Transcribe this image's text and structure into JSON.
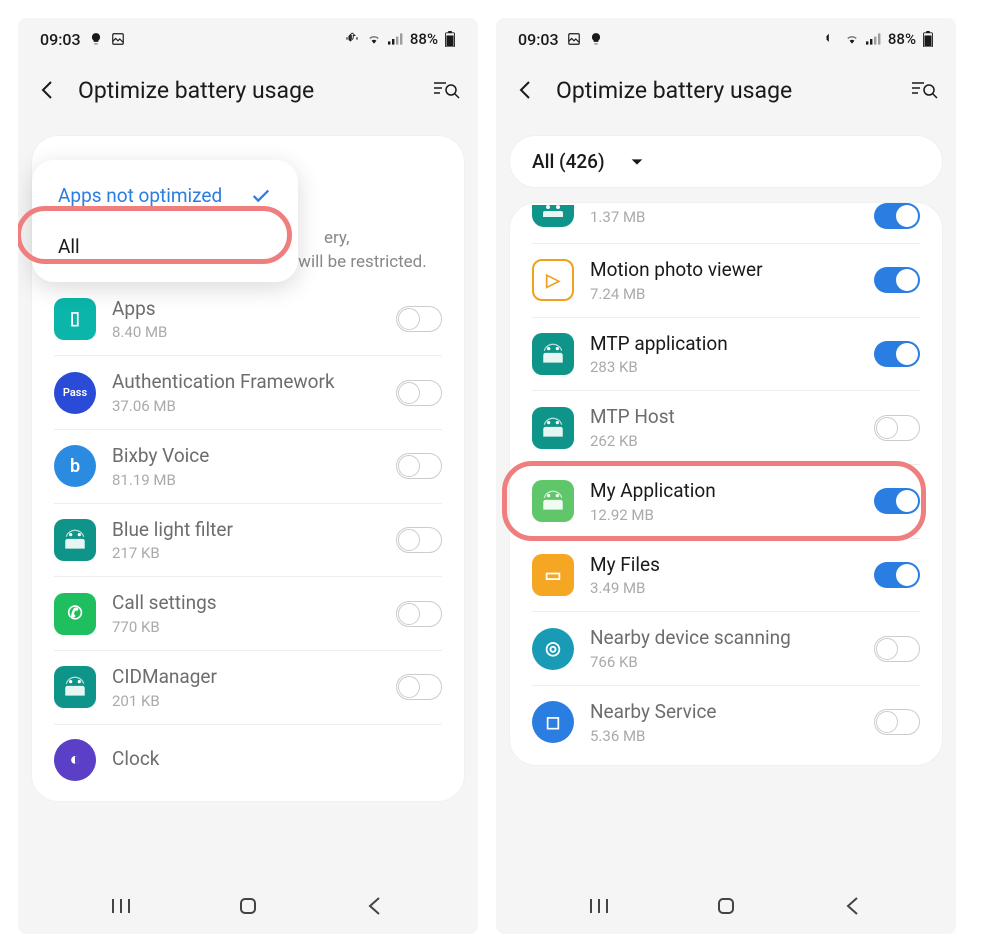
{
  "status": {
    "time": "09:03",
    "battery_pct": "88%"
  },
  "header": {
    "title": "Optimize battery usage"
  },
  "left_screen": {
    "dropdown": {
      "option_selected": "Apps not optimized",
      "option_all": "All"
    },
    "description_tail": "but some background functions will be restricted.",
    "description_partial_word": "ery,",
    "apps": [
      {
        "name": "Apps",
        "size": "8.40 MB",
        "icon_bg": "#0bb5a9",
        "icon_shape": "square",
        "glyph": "▯",
        "active": false,
        "on": false
      },
      {
        "name": "Authentication Framework",
        "size": "37.06 MB",
        "icon_bg": "#2a4bd7",
        "icon_shape": "circle",
        "glyph": "Pass",
        "glyph_size": "11px",
        "active": false,
        "on": false
      },
      {
        "name": "Bixby Voice",
        "size": "81.19 MB",
        "icon_bg": "#2a8be1",
        "icon_shape": "circle",
        "glyph": "b",
        "active": false,
        "on": false
      },
      {
        "name": "Blue light filter",
        "size": "217 KB",
        "icon_bg": "#0e9488",
        "icon_shape": "square",
        "glyph": "◉",
        "active": false,
        "on": false
      },
      {
        "name": "Call settings",
        "size": "770 KB",
        "icon_bg": "#1fbf5f",
        "icon_shape": "square",
        "glyph": "✆",
        "active": false,
        "on": false
      },
      {
        "name": "CIDManager",
        "size": "201 KB",
        "icon_bg": "#0e9488",
        "icon_shape": "square",
        "glyph": "◉",
        "active": false,
        "on": false
      },
      {
        "name": "Clock",
        "size": "",
        "icon_bg": "#5b3fc7",
        "icon_shape": "circle",
        "glyph": "◐",
        "active": false,
        "on": false,
        "no_toggle": true
      }
    ]
  },
  "right_screen": {
    "filter_label": "All (426)",
    "partial_size": "1.37 MB",
    "apps": [
      {
        "name": "Motion photo viewer",
        "size": "7.24 MB",
        "icon_bg": "#fff",
        "icon_border": "#f0a020",
        "icon_shape": "square",
        "glyph": "▷",
        "glyph_color": "#f0a020",
        "active": true,
        "on": true
      },
      {
        "name": "MTP application",
        "size": "283 KB",
        "icon_bg": "#0e9488",
        "icon_shape": "square",
        "glyph": "◉",
        "active": true,
        "on": true
      },
      {
        "name": "MTP Host",
        "size": "262 KB",
        "icon_bg": "#0e9488",
        "icon_shape": "square",
        "glyph": "◉",
        "active": false,
        "on": false
      },
      {
        "name": "My Application",
        "size": "12.92 MB",
        "icon_bg": "#5fc76a",
        "icon_shape": "square",
        "glyph": "◉",
        "active": true,
        "on": true,
        "highlight": true
      },
      {
        "name": "My Files",
        "size": "3.49 MB",
        "icon_bg": "#f5a623",
        "icon_shape": "square",
        "glyph": "▭",
        "active": true,
        "on": true
      },
      {
        "name": "Nearby device scanning",
        "size": "766 KB",
        "icon_bg": "#1a9bb5",
        "icon_shape": "circle",
        "glyph": "◎",
        "active": false,
        "on": false
      },
      {
        "name": "Nearby Service",
        "size": "5.36 MB",
        "icon_bg": "#2a7de1",
        "icon_shape": "circle",
        "glyph": "◻",
        "active": false,
        "on": false
      }
    ]
  }
}
